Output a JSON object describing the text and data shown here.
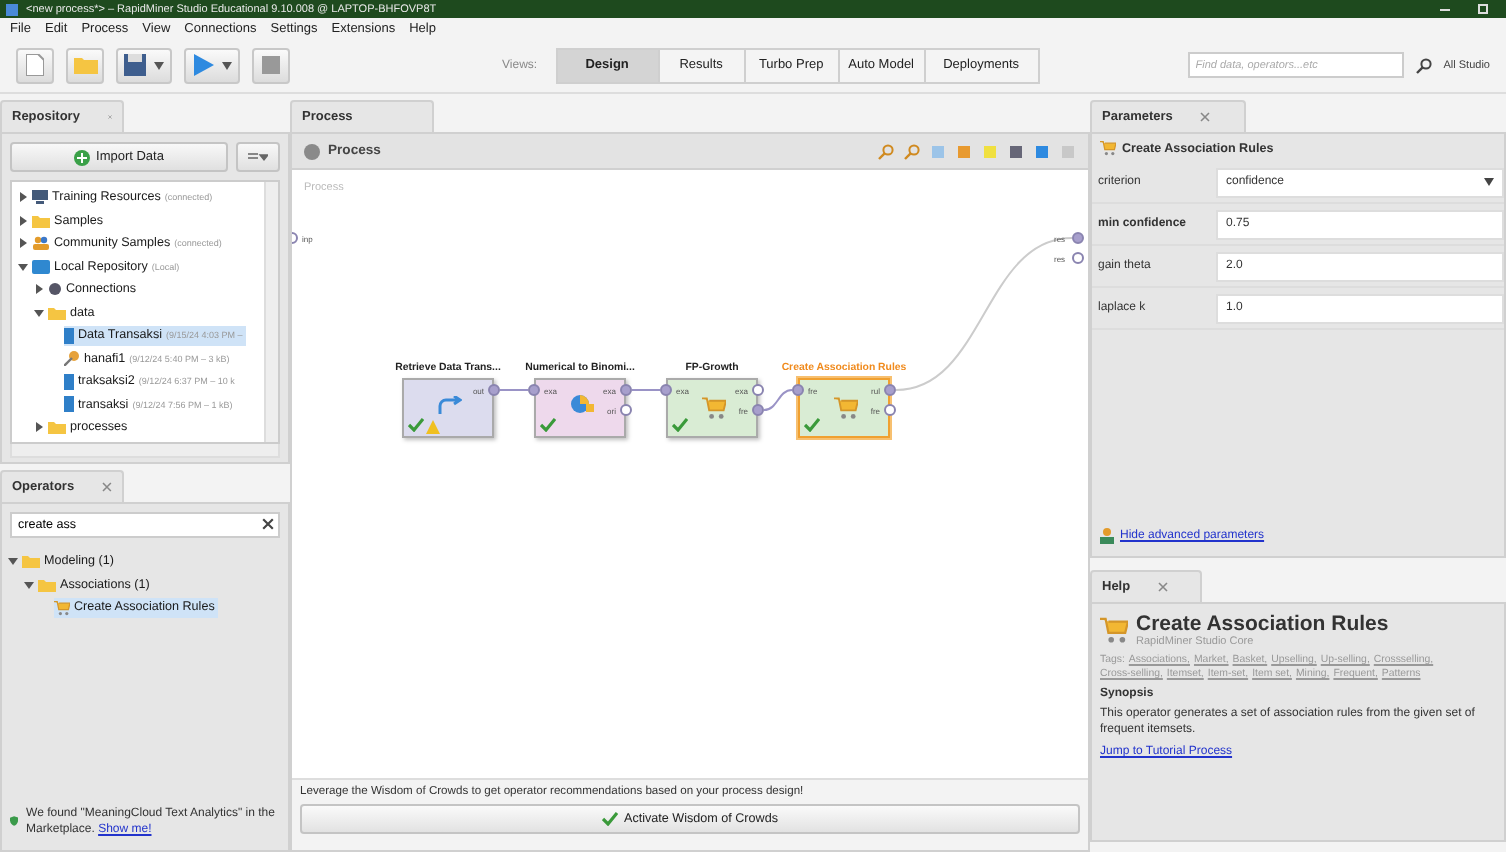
{
  "window": {
    "title": "<new process*> – RapidMiner Studio Educational 9.10.008 @ LAPTOP-BHFOVP8T"
  },
  "menu": [
    "File",
    "Edit",
    "Process",
    "View",
    "Connections",
    "Settings",
    "Extensions",
    "Help"
  ],
  "views_label": "Views:",
  "views": [
    {
      "label": "Design",
      "selected": true
    },
    {
      "label": "Results",
      "selected": false
    },
    {
      "label": "Turbo Prep",
      "selected": false
    },
    {
      "label": "Auto Model",
      "selected": false
    },
    {
      "label": "Deployments",
      "selected": false
    }
  ],
  "search": {
    "placeholder": "Find data, operators...etc"
  },
  "studio_button": "All Studio",
  "repository": {
    "tab": "Repository",
    "import_button": "Import Data",
    "tree": [
      {
        "label": "Training Resources",
        "note": "(connected)",
        "kind": "monitor",
        "expanded": false,
        "selected": false
      },
      {
        "label": "Samples",
        "kind": "folder",
        "expanded": false,
        "selected": false
      },
      {
        "label": "Community Samples",
        "note": "(connected)",
        "kind": "people",
        "expanded": false,
        "selected": false
      },
      {
        "label": "Local Repository",
        "note": "(Local)",
        "kind": "repository",
        "expanded": true,
        "selected": false,
        "children": [
          {
            "label": "Connections",
            "kind": "connections",
            "expanded": false,
            "selected": false
          },
          {
            "label": "data",
            "kind": "folder",
            "expanded": true,
            "selected": false,
            "children": [
              {
                "label": "Data Transaksi",
                "note": "(9/15/24 4:03 PM –",
                "kind": "data",
                "selected": true
              },
              {
                "label": "hanafi1",
                "note": "(9/12/24 5:40 PM – 3 kB)",
                "kind": "model",
                "selected": false
              },
              {
                "label": "traksaksi2",
                "note": "(9/12/24 6:37 PM – 10 k",
                "kind": "data",
                "selected": false
              },
              {
                "label": "transaksi",
                "note": "(9/12/24 7:56 PM – 1 kB)",
                "kind": "data",
                "selected": false
              }
            ]
          },
          {
            "label": "processes",
            "kind": "folder",
            "expanded": false,
            "selected": false
          }
        ]
      }
    ]
  },
  "operators": {
    "tab": "Operators",
    "search": {
      "value": "create ass"
    },
    "tree": [
      {
        "label": "Modeling (1)",
        "kind": "folder",
        "expanded": true,
        "selected": false,
        "children": [
          {
            "label": "Associations (1)",
            "kind": "folder",
            "expanded": true,
            "selected": false,
            "children": [
              {
                "label": "Create Association Rules",
                "kind": "operator",
                "selected": true
              }
            ]
          }
        ]
      }
    ],
    "notice": {
      "text": "We found \"MeaningCloud Text Analytics\" in the Marketplace.",
      "link": "Show me!"
    }
  },
  "process": {
    "tab": "Process",
    "breadcrumb": "Process",
    "canvas_label": "Process",
    "input_port": "inp",
    "output_ports": [
      "res",
      "res"
    ],
    "nodes": [
      {
        "name": "Retrieve Data Trans...",
        "kind": "retrieve",
        "color": "#dcdcee",
        "selected": false,
        "ok": true,
        "warning": true,
        "outputs": [
          {
            "label": "out",
            "connected": true
          }
        ]
      },
      {
        "name": "Numerical to Binomi...",
        "kind": "convert",
        "color": "#eed9ec",
        "selected": false,
        "ok": true,
        "warning": false,
        "inputs": [
          {
            "label": "exa",
            "connected": true
          }
        ],
        "outputs": [
          {
            "label": "exa",
            "connected": true
          },
          {
            "label": "ori",
            "connected": false
          }
        ]
      },
      {
        "name": "FP-Growth",
        "kind": "cart",
        "color": "#d9ecd4",
        "selected": false,
        "ok": true,
        "warning": false,
        "inputs": [
          {
            "label": "exa",
            "connected": true
          }
        ],
        "outputs": [
          {
            "label": "exa",
            "connected": false
          },
          {
            "label": "fre",
            "connected": true
          }
        ]
      },
      {
        "name": "Create Association Rules",
        "kind": "cart",
        "color": "#d9ecd4",
        "selected": true,
        "ok": true,
        "warning": false,
        "inputs": [
          {
            "label": "fre",
            "connected": true
          }
        ],
        "outputs": [
          {
            "label": "rul",
            "connected": true
          },
          {
            "label": "fre",
            "connected": false
          }
        ]
      }
    ]
  },
  "wisdom": {
    "message": "Leverage the Wisdom of Crowds to get operator recommendations based on your process design!",
    "button": "Activate Wisdom of Crowds"
  },
  "parameters": {
    "tab": "Parameters",
    "operator": "Create Association Rules",
    "rows": [
      {
        "label": "criterion",
        "value": "confidence",
        "kind": "dropdown",
        "bold": false
      },
      {
        "label": "min confidence",
        "value": "0.75",
        "kind": "text",
        "bold": true
      },
      {
        "label": "gain theta",
        "value": "2.0",
        "kind": "text",
        "bold": false
      },
      {
        "label": "laplace k",
        "value": "1.0",
        "kind": "text",
        "bold": false
      }
    ],
    "advanced_link": "Hide advanced parameters"
  },
  "help": {
    "tab": "Help",
    "title": "Create Association Rules",
    "subtitle": "RapidMiner Studio Core",
    "tags_label": "Tags:",
    "tags": [
      "Associations,",
      "Market,",
      "Basket,",
      "Upselling,",
      "Up-selling,",
      "Crossselling,",
      "Cross-selling,",
      "Itemset,",
      "Item-set,",
      "Item set,",
      "Mining,",
      "Frequent,",
      "Patterns"
    ],
    "synopsis_heading": "Synopsis",
    "synopsis": "This operator generates a set of association rules from the given set of frequent itemsets.",
    "tutorial_link": "Jump to Tutorial Process"
  }
}
